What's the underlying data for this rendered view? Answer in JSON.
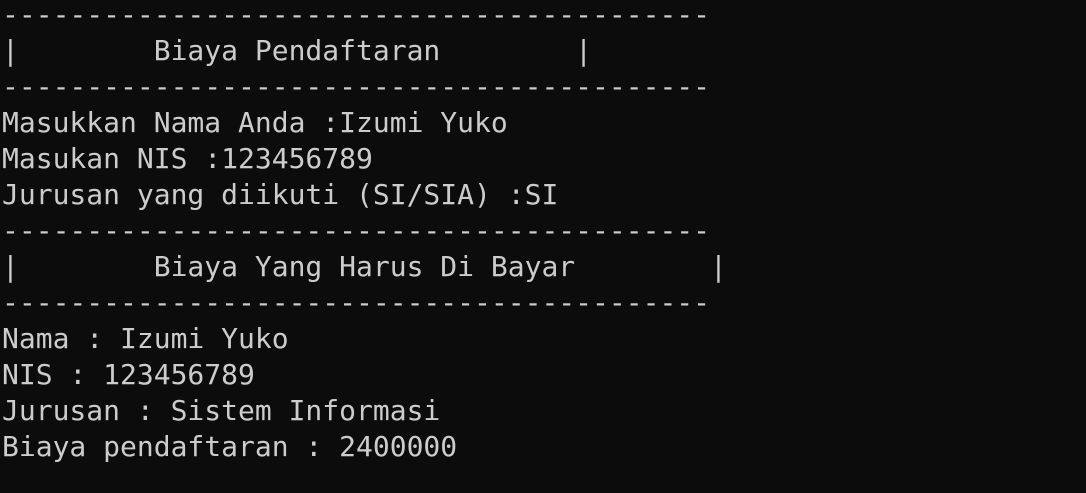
{
  "console": {
    "lines": [
      "------------------------------------------",
      "|        Biaya Pendaftaran        |",
      "------------------------------------------",
      "Masukkan Nama Anda :Izumi Yuko",
      "Masukan NIS :123456789",
      "Jurusan yang diikuti (SI/SIA) :SI",
      "------------------------------------------",
      "|        Biaya Yang Harus Di Bayar        |",
      "------------------------------------------",
      "Nama : Izumi Yuko",
      "NIS : 123456789",
      "Jurusan : Sistem Informasi",
      "Biaya pendaftaran : 2400000"
    ]
  },
  "colors": {
    "background": "#0c0c0c",
    "text": "#cccccc"
  }
}
